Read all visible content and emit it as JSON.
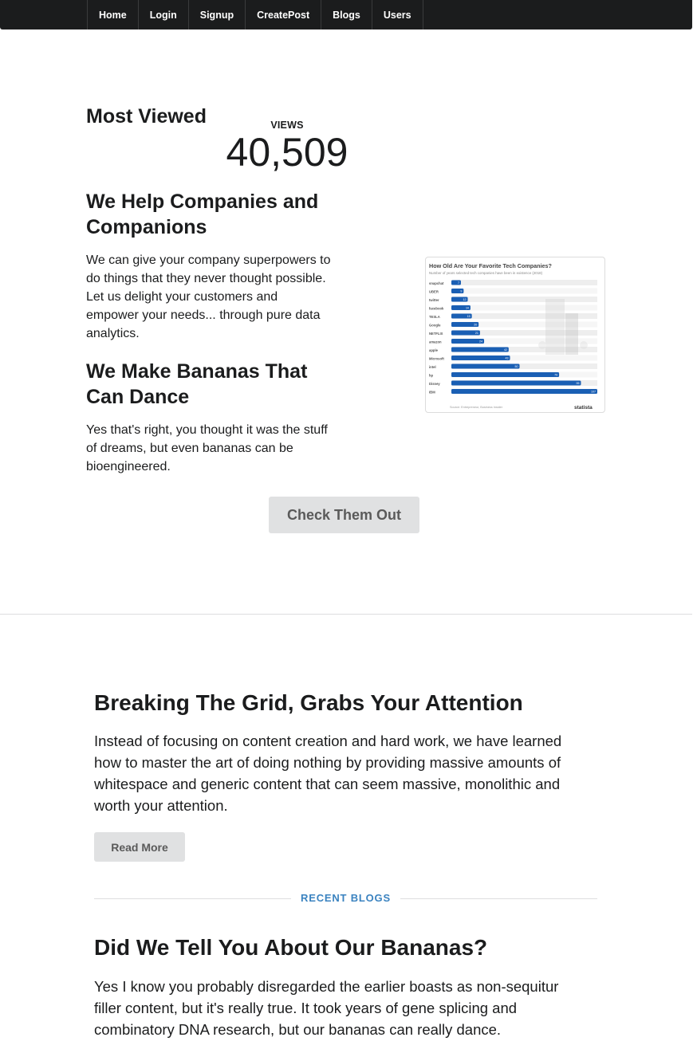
{
  "nav": {
    "items": [
      "Home",
      "Login",
      "Signup",
      "CreatePost",
      "Blogs",
      "Users"
    ]
  },
  "hero": {
    "most_viewed": "Most Viewed",
    "stat_label": "VIEWS",
    "stat_value": "40,509",
    "heading1": "We Help Companies and Companions",
    "paragraph1": "We can give your company superpowers to do things that they never thought possible. Let us delight your customers and empower your needs... through pure data analytics.",
    "heading2": "We Make Bananas That Can Dance",
    "paragraph2": "Yes that's right, you thought it was the stuff of dreams, but even bananas can be bioengineered.",
    "button": "Check Them Out"
  },
  "chart_image": {
    "title": "How Old Are Your Favorite Tech Companies?",
    "subtitle": "Number of years selected tech companies have been in existence (2018)",
    "companies": [
      "snapchat",
      "UBER",
      "twitter",
      "facebook",
      "TESLA",
      "Google",
      "NETFLIX",
      "amazon",
      "apple",
      "Microsoft",
      "intel",
      "hp",
      "Disney",
      "IBM"
    ],
    "values": [
      7,
      9,
      12,
      14,
      15,
      20,
      21,
      24,
      42,
      43,
      50,
      79,
      95,
      107
    ],
    "source": "Source: Entrepreneur, Business Insider",
    "brand": "statista"
  },
  "article": {
    "title": "Breaking The Grid, Grabs Your Attention",
    "text": "Instead of focusing on content creation and hard work, we have learned how to master the art of doing nothing by providing massive amounts of whitespace and generic content that can seem massive, monolithic and worth your attention.",
    "button": "Read More",
    "divider_label": "RECENT BLOGS",
    "title2": "Did We Tell You About Our Bananas?",
    "text2": "Yes I know you probably disregarded the earlier boasts as non-sequitur filler content, but it's really true. It took years of gene splicing and combinatory DNA research, but our bananas can really dance."
  }
}
